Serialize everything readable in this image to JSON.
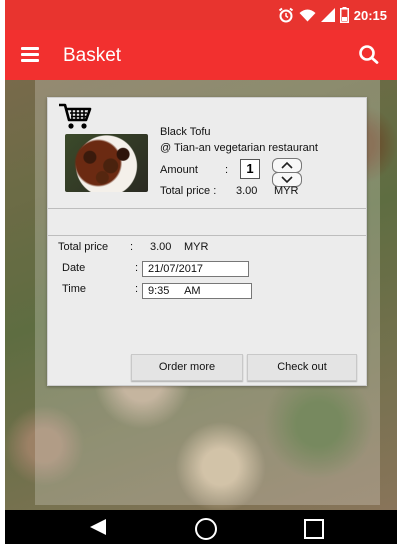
{
  "status_bar": {
    "time": "20:15",
    "icons": [
      "alarm-icon",
      "wifi-icon",
      "signal-icon",
      "battery-icon"
    ]
  },
  "app_bar": {
    "title": "Basket",
    "menu_icon": "menu-icon",
    "search_icon": "search-icon",
    "color": "#f2302f"
  },
  "basket_item": {
    "cart_icon": "shopping-cart-icon",
    "name": "Black Tofu",
    "restaurant": "@ Tian-an vegetarian restaurant",
    "amount_label": "Amount",
    "amount_colon": ":",
    "amount_value": "1",
    "total_label": "Total price :",
    "total_value": "3.00",
    "currency": "MYR"
  },
  "summary": {
    "total_label": "Total price",
    "total_colon": ":",
    "total_value": "3.00",
    "currency": "MYR",
    "date_label": "Date",
    "date_colon": ":",
    "date_value": "21/07/2017",
    "time_label": "Time",
    "time_colon": ":",
    "time_value": "9:35     AM"
  },
  "buttons": {
    "order_more": "Order more",
    "check_out": "Check out"
  },
  "nav_bar": {
    "back_icon": "back-icon",
    "home_icon": "home-icon",
    "recents_icon": "recents-icon"
  }
}
